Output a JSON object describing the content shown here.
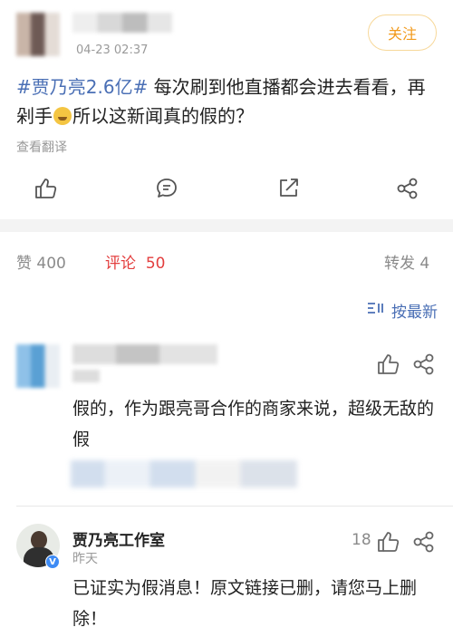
{
  "post": {
    "time": "04-23 02:37",
    "follow_label": "关注",
    "hashtag": "#贾乃亮2.6亿#",
    "text_part1": " 每次刷到他直播都会进去看看，再剁手",
    "text_part2": "所以这新闻真的假的？",
    "translate_label": "查看翻译"
  },
  "stats": {
    "likes": "赞 400",
    "comments_label": "评论",
    "comments_count": "50",
    "reposts": "转发 4"
  },
  "sort": {
    "label": "按最新"
  },
  "comments": [
    {
      "text": "假的，作为跟亮哥合作的商家来说，超级无敌的假"
    },
    {
      "name": "贾乃亮工作室",
      "time": "昨天",
      "likes": "18",
      "text": "已证实为假消息！原文链接已删，请您马上删除！",
      "badge": "V"
    }
  ],
  "colors": {
    "accent_orange": "#f29a1c",
    "link_blue": "#4a6fb5",
    "active_red": "#e33e3e"
  }
}
